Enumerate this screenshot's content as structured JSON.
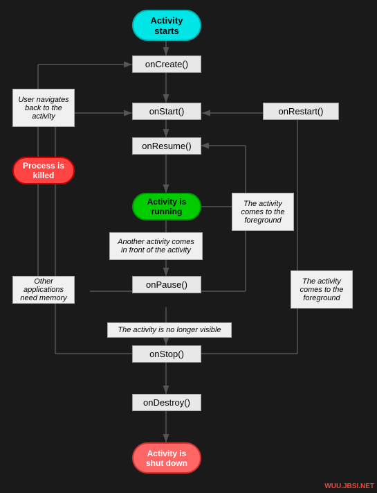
{
  "nodes": {
    "activity_starts": "Activity\nstarts",
    "oncreate": "onCreate()",
    "onstart": "onStart()",
    "onrestart": "onRestart()",
    "onresume": "onResume()",
    "activity_running": "Activity is\nrunning",
    "onpause": "onPause()",
    "onstop": "onStop()",
    "ondestroy": "onDestroy()",
    "activity_shutdown": "Activity is\nshut down"
  },
  "labels": {
    "user_navigates": "User navigates\nback to the\nactivity",
    "process_killed": "Process is\nkilled",
    "another_activity": "Another activity comes\nin front of the activity",
    "no_longer_visible": "The activity is no longer visible",
    "other_apps": "Other applications\nneed memory",
    "comes_foreground_1": "The activity\ncomes to the\nforeground",
    "comes_foreground_2": "The activity\ncomes to the\nforeground"
  },
  "watermark": "WUU.JBSI.NET"
}
